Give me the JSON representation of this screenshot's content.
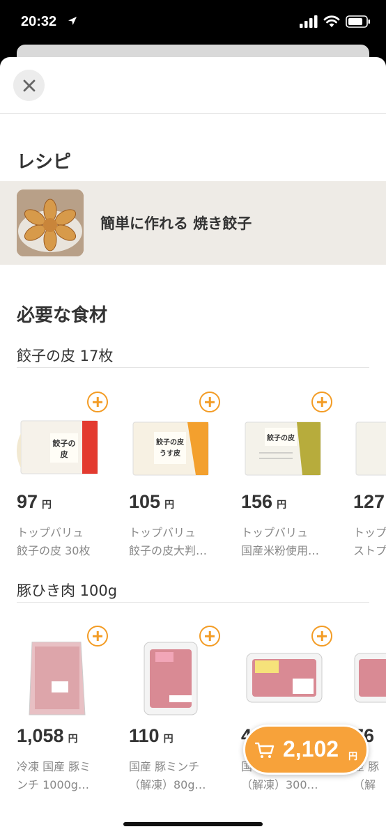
{
  "status_bar": {
    "time": "20:32"
  },
  "recipe_section": {
    "title": "レシピ",
    "recipe_name": "簡単に作れる 焼き餃子"
  },
  "ingredients_section": {
    "title": "必要な食材",
    "groups": [
      {
        "title": "餃子の皮 17枚",
        "products": [
          {
            "price": "97",
            "yen": "円",
            "brand": "トップバリュ",
            "name": "餃子の皮 30枚",
            "package_text": "餃子の皮",
            "accent": "#e33a2f"
          },
          {
            "price": "105",
            "yen": "円",
            "brand": "トップバリュ",
            "name": "餃子の皮大判…",
            "package_text": "餃子の皮 うす皮",
            "accent": "#f3a02e"
          },
          {
            "price": "156",
            "yen": "円",
            "brand": "トップバリュ",
            "name": "国産米粉使用…",
            "package_text": "餃子の皮",
            "accent": "#b7ac3c"
          },
          {
            "price": "127",
            "yen": "円",
            "brand": "トップ",
            "name": "ストプ",
            "package_text": "",
            "accent": "#d9d9d9"
          }
        ]
      },
      {
        "title": "豚ひき肉 100g",
        "products": [
          {
            "price": "1,058",
            "yen": "円",
            "brand": "冷凍 国産 豚ミ",
            "name": "ンチ 1000g…"
          },
          {
            "price": "110",
            "yen": "円",
            "brand": "国産 豚ミンチ",
            "name": "（解凍）80g…"
          },
          {
            "price": "4",
            "yen": "",
            "brand": "国",
            "name": "（解凍）300…"
          },
          {
            "price": "76",
            "yen": "",
            "brand": "産 豚",
            "name": "（解"
          }
        ]
      }
    ]
  },
  "cart": {
    "total": "2,102",
    "yen": "円"
  },
  "colors": {
    "accent": "#f39c25",
    "cart": "#f7a23a",
    "recipe_bg": "#eeebe6"
  }
}
